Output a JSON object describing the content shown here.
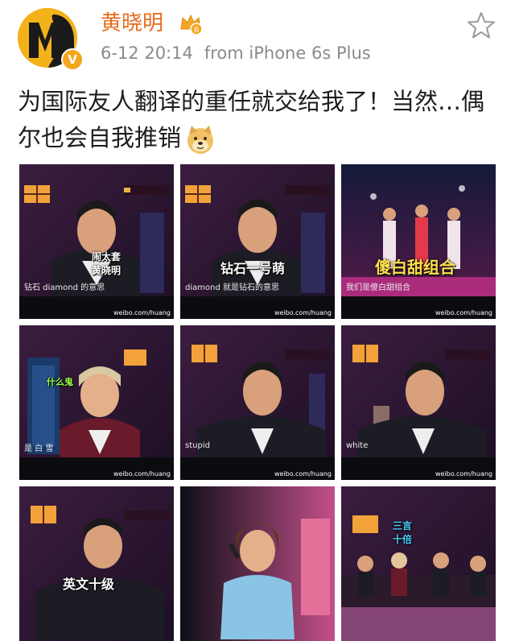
{
  "user": {
    "name": "黄晓明",
    "verified_glyph": "V",
    "level_badge": "6"
  },
  "meta": {
    "datetime": "6-12 20:14",
    "source": "from iPhone 6s Plus"
  },
  "post": {
    "text": "为国际友人翻译的重任就交给我了！当然…偶尔也会自我推销",
    "emoji": "doge-emoji"
  },
  "icons": {
    "favorite": "star-outline-icon",
    "crown": "crown-badge-icon"
  },
  "colors": {
    "username": "#e86b1b",
    "meta": "#8a8a8a",
    "badge": "#f3a51b"
  },
  "photos": [
    {
      "caption": "闹太套\n黄晓明",
      "subtitle": "钻石 diamond 的意思",
      "watermark": "weibo.com/huang"
    },
    {
      "caption": "钻石一号萌",
      "subtitle": "diamond 就是钻石的意思",
      "watermark": "weibo.com/huang"
    },
    {
      "caption": "傻白甜组合",
      "subtitle": "我们是傻白甜组合",
      "watermark": "weibo.com/huang"
    },
    {
      "caption": "什么鬼",
      "subtitle": "是 白 雪",
      "watermark": "weibo.com/huang"
    },
    {
      "caption": "",
      "subtitle": "stupid",
      "watermark": "weibo.com/huang"
    },
    {
      "caption": "",
      "subtitle": "white",
      "watermark": "weibo.com/huang"
    },
    {
      "caption": "英文十级",
      "subtitle": "",
      "watermark": ""
    },
    {
      "caption": "",
      "subtitle": "",
      "watermark": ""
    },
    {
      "caption": "三言\n十倍",
      "subtitle": "",
      "watermark": ""
    }
  ]
}
